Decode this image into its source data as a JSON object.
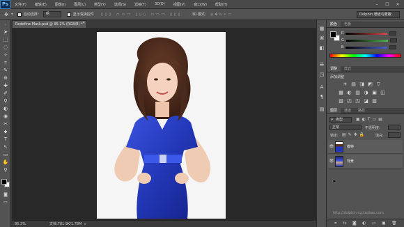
{
  "app": {
    "logo": "Ps"
  },
  "menu": [
    "文件(F)",
    "编辑(E)",
    "图像(I)",
    "图层(L)",
    "类型(Y)",
    "选择(S)",
    "滤镜(T)",
    "3D(D)",
    "视图(V)",
    "窗口(W)",
    "帮助(H)"
  ],
  "window_controls": [
    "–",
    "☐",
    "✕"
  ],
  "options": {
    "auto_select_label": "自动选择：",
    "auto_select_value": "组",
    "transform_label": "显示变换控件",
    "mode_3d": "3D 模式：",
    "workspace": "Dolphin 通道与蒙版"
  },
  "document": {
    "tab_title": "Redefine-Mask.psd @ 95.2% (RGB/8) *",
    "zoom": "95.2%",
    "doc_size": "文档:781.9K/1.78M",
    "watermark": "http://dolphin-cg.taobao.com"
  },
  "tools": [
    "➤",
    "⬚",
    "◌",
    "✧",
    "⌗",
    "✎",
    "⊕",
    "✚",
    "✐",
    "⚲",
    "◐",
    "◉",
    "✂",
    "⬥",
    "T",
    "↖",
    "▭",
    "✋",
    "⚲"
  ],
  "right_icons": [
    "▦",
    "⌘",
    "◧",
    "☰",
    "◳",
    "A",
    "¶",
    "▤"
  ],
  "color_panel": {
    "tabs": [
      "颜色",
      "色板"
    ],
    "sliders": [
      {
        "label": "R",
        "color": "#d14a4a"
      },
      {
        "label": "G",
        "color": "#4fb04f"
      },
      {
        "label": "B",
        "color": "#4a5cd1"
      }
    ]
  },
  "adjustments_panel": {
    "tabs": [
      "调整",
      "样式"
    ],
    "add_label": "添加调整",
    "icons": [
      "☀",
      "▤",
      "◨",
      "◩",
      "▽",
      "▦",
      "◐",
      "▥",
      "◑",
      "▣",
      "◫",
      "▧",
      "◰",
      "◳",
      "◪",
      "▨"
    ]
  },
  "layers_panel": {
    "tabs": [
      "图层",
      "通道",
      "路径"
    ],
    "filter_label": "类型",
    "blend_mode": "正常",
    "opacity_label": "不透明度:",
    "lock_label": "锁定:",
    "fill_label": "填充:",
    "layers": [
      {
        "name": "模特",
        "visible": true
      },
      {
        "name": "背景",
        "visible": true
      }
    ],
    "bottom_icons": [
      "⚭",
      "fx",
      "◙",
      "◐",
      "▭",
      "▣",
      "🗑"
    ]
  },
  "colors": {
    "foreground": "#000000",
    "background": "#ffffff",
    "accent_blue": "#2b45c9"
  }
}
